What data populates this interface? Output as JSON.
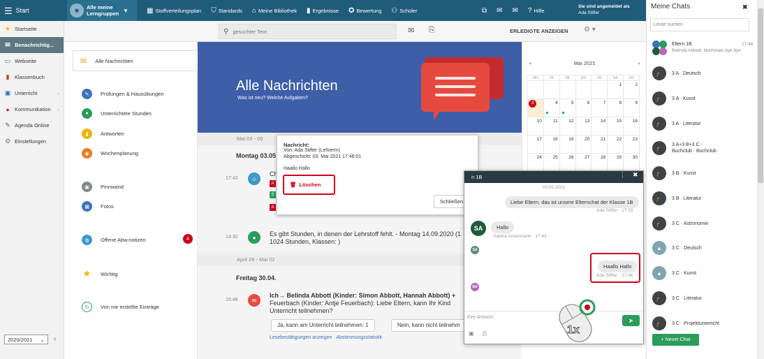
{
  "topbar": {
    "start": "Start",
    "group_label": "Alle meine Lerngruppen",
    "items": [
      "Stoffverteilungsplan",
      "Standards",
      "Meine Bibliothek",
      "Ergebnisse",
      "Bewertung",
      "Schüler"
    ],
    "help": "Hilfe",
    "login_line": "Sie sind angemeldet als",
    "user_name": "Ada Stifter"
  },
  "sidebar": {
    "items": [
      "Startseite",
      "Benachrichtig...",
      "Webseite",
      "Klassenbuch",
      "Unterricht",
      "Kommunikation",
      "Agenda Online",
      "Einstellungen"
    ],
    "year": "2020/2021"
  },
  "search": {
    "placeholder": "gesuchter Text",
    "done": "ERLEDIGTE ANZEIGEN"
  },
  "categories": {
    "all": "Alle Nachrichten",
    "items": [
      "Prüfungen & Hausübungen",
      "Unterrichtete Stunden",
      "Antworten",
      "Wochenplanung",
      "Pinnwand",
      "Fotos",
      "Offene Abw.notizen",
      "Wichtig",
      "Von mir erstellte Einträge"
    ],
    "badge": "4"
  },
  "hero": {
    "title": "Alle Nachrichten",
    "subtitle": "Was ist neu? Welche Aufgaben?"
  },
  "messages": {
    "date1": "Mai 03 - 09",
    "day1": "Montag 03.05",
    "time1": "17:43",
    "text1": "Ch",
    "time2": "14:30",
    "text2a": "Es gibt Stunden, in denen der Lehrstoff fehlt. - Montag 14.09.2020 (1",
    "text2b": "1024 Stunden, Klassen: )",
    "date2": "April 26 - Mai 02",
    "day2": "Freitag 30.04.",
    "time3": "16:48",
    "text3a": "Ich→ Belinda Abbott (Kinder: Simon Abbott, Hannah Abbott) +",
    "text3b": "Feuerbach (Kinder: Antje Feuerbach): Liebe Eltern, kann Ihr Kind",
    "text3c": "Unterricht teilnehmen?",
    "reply_yes": "Ja, kann am Unterricht teilnehmen: 1",
    "reply_no": "Nein, kann nicht teilnehm",
    "links": "Lesebestätigungen anzeigen · Abstimmungsstatistik"
  },
  "calendar": {
    "month": "Mai 2021",
    "weekdays": [
      "MO",
      "DI",
      "MI",
      "DO",
      "FR",
      "SA",
      "SO"
    ],
    "weeks": [
      [
        "",
        "",
        "",
        "",
        "",
        "1",
        "2"
      ],
      [
        "3",
        "4",
        "5",
        "6",
        "7",
        "8",
        "9"
      ],
      [
        "10",
        "11",
        "12",
        "13",
        "14",
        "15",
        "16"
      ],
      [
        "17",
        "18",
        "19",
        "20",
        "21",
        "22",
        "23"
      ],
      [
        "24",
        "25",
        "26",
        "27",
        "28",
        "29",
        "30"
      ]
    ],
    "today_count": "3"
  },
  "popup": {
    "label": "Nachricht:",
    "from": "Von: Ada Stifter (LehrerIn)",
    "sent": "Abgeschickt: 03. Mai 2021 17:46:01",
    "body": "Haallo Hallo",
    "delete": "Löschen",
    "close": "Schließen"
  },
  "chat": {
    "title": "n 1B",
    "date": "03.05.2021",
    "msg1": "Liebe Eltern, das ist  unsere Elternchat der Klasse 1B",
    "meta1": "Ada Stifter · 17:33",
    "msg2": "Hallo",
    "meta2": "Sabine Ackermann · 17:43",
    "msg3": "Haallo Hallo",
    "meta3": "Ada Stifter · 17:46",
    "placeholder": "Ihre Antwort",
    "sa": "SA",
    "ba": "BA",
    "click_count": "1x"
  },
  "right_panel": {
    "title": "Meine Chats",
    "search_placeholder": "Leute suchen",
    "first_name": "Eltern 1B",
    "first_time": "17:48",
    "first_preview": "Belinda Abbott: Nochmals bye bye",
    "chats": [
      "3 A · Deutsch",
      "3 A · Kunst",
      "3 A · Literatur",
      "3 A+3 B+3 C - Buchclub · Buchclub",
      "3 B · Kunst",
      "3 B · Literatur",
      "3 C · Astronomie",
      "3 C · Deutsch",
      "3 C · Kunst",
      "3 C · Literatur",
      "3 C · Projektunterricht"
    ],
    "new_chat": "+ Neuer Chat"
  },
  "colors": {
    "topbar": "#1f5c7a",
    "hero": "#3e5fa8",
    "alert_red": "#d0021b",
    "send_green": "#2a9d5a"
  }
}
